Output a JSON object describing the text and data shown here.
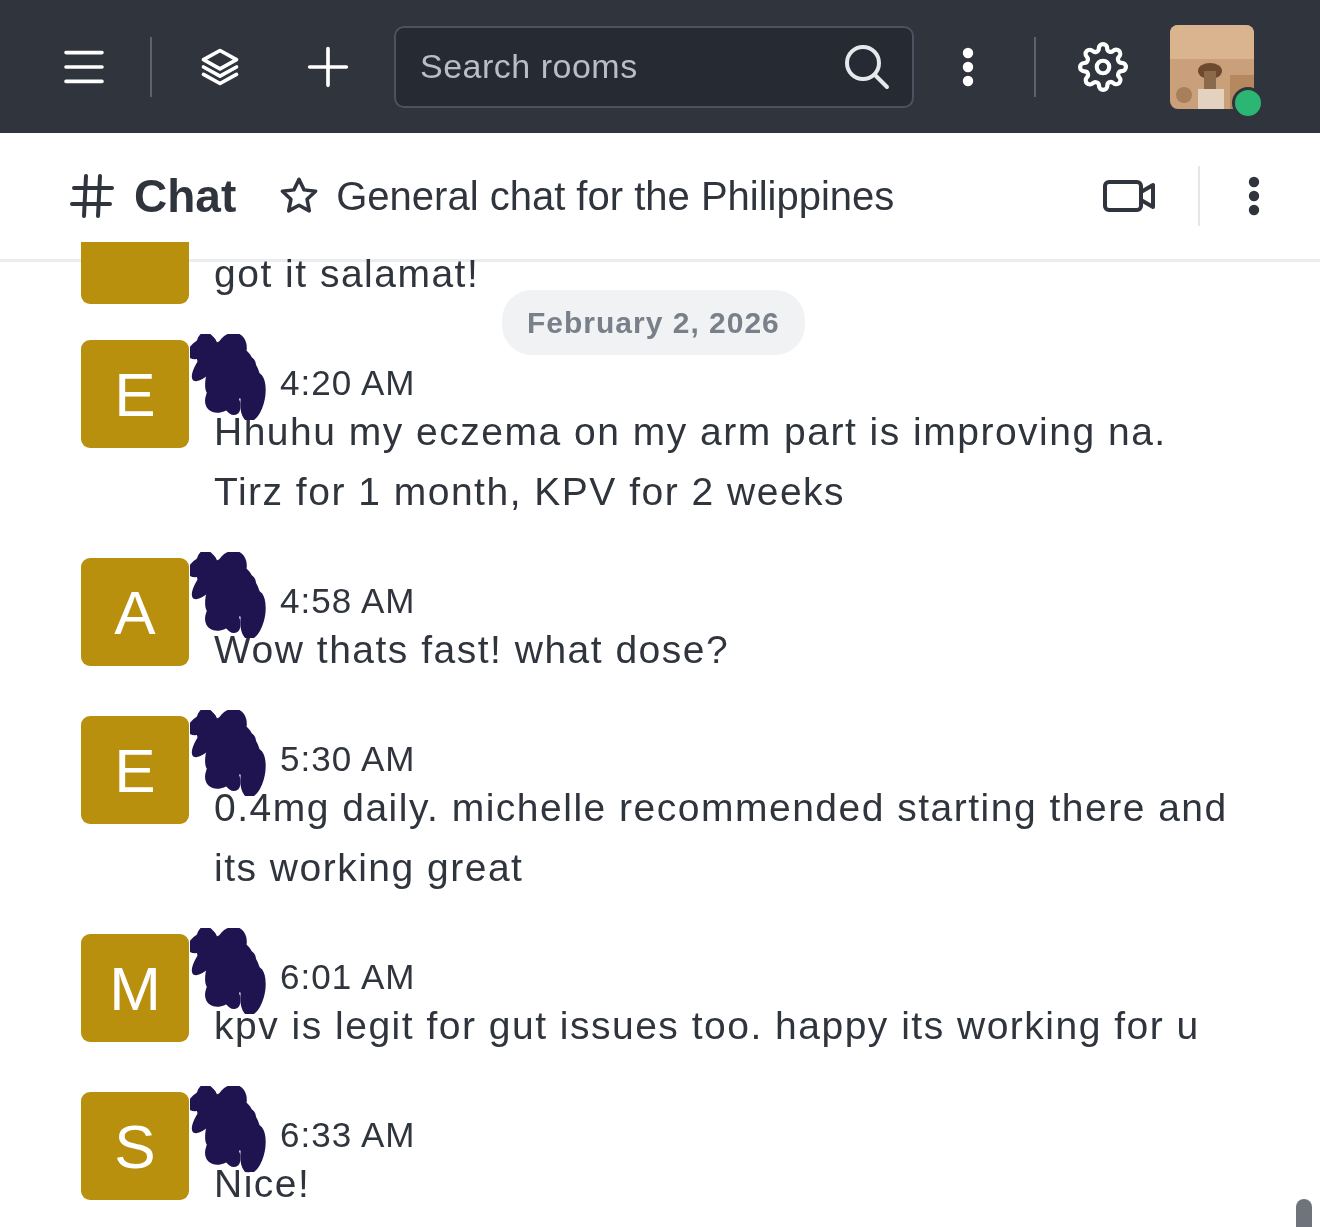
{
  "top_bar": {
    "search": {
      "placeholder": "Search rooms"
    },
    "user_status": {
      "color": "#2bb673"
    }
  },
  "room": {
    "name": "Chat",
    "favorite": false,
    "topic": "General chat for the Philippines"
  },
  "date_divider": "February 2, 2026",
  "messages": [
    {
      "text": "got it salamat!"
    },
    {
      "avatar_letter": "E",
      "redacted_name": true,
      "time": "4:20 AM",
      "text": "Hhuhu my eczema on my arm part is improving na. Tirz for 1 month, KPV for 2 weeks"
    },
    {
      "avatar_letter": "A",
      "redacted_name": true,
      "time": "4:58 AM",
      "text": "Wow thats fast! what dose?"
    },
    {
      "avatar_letter": "E",
      "redacted_name": true,
      "time": "5:30 AM",
      "text": "0.4mg daily. michelle recommended starting there and its working great"
    },
    {
      "avatar_letter": "M",
      "redacted_name": true,
      "time": "6:01 AM",
      "text": "kpv is legit for gut issues too. happy its working for u"
    },
    {
      "avatar_letter": "S",
      "redacted_name": true,
      "time": "6:33 AM",
      "text": "Nice!"
    }
  ]
}
